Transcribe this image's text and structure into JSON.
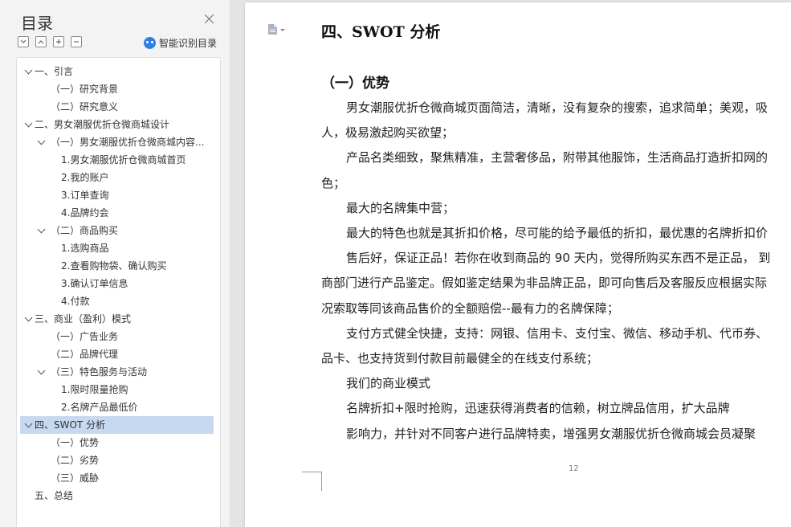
{
  "toc": {
    "title": "目录",
    "smart_label": "智能识别目录",
    "items": [
      {
        "label": "一、引言",
        "level": 0,
        "expanded": true
      },
      {
        "label": "（一）研究背景",
        "level": 1
      },
      {
        "label": "（二）研究意义",
        "level": 1
      },
      {
        "label": "二、男女潮服优折仓微商城设计",
        "level": 0,
        "expanded": true
      },
      {
        "label": "（一）男女潮服优折仓微商城内容...",
        "level": 1,
        "expanded": true
      },
      {
        "label": "1.男女潮服优折仓微商城首页",
        "level": 2
      },
      {
        "label": "2.我的账户",
        "level": 2
      },
      {
        "label": "3.订单查询",
        "level": 2
      },
      {
        "label": "4.品牌约会",
        "level": 2
      },
      {
        "label": "（二）商品购买",
        "level": 1,
        "expanded": true
      },
      {
        "label": "1.选购商品",
        "level": 2
      },
      {
        "label": "2.查看购物袋、确认购买",
        "level": 2
      },
      {
        "label": "3.确认订单信息",
        "level": 2
      },
      {
        "label": "4.付款",
        "level": 2
      },
      {
        "label": "三、商业（盈利）模式",
        "level": 0,
        "expanded": true
      },
      {
        "label": "（一）广告业务",
        "level": 1
      },
      {
        "label": "（二）品牌代理",
        "level": 1
      },
      {
        "label": "（三）特色服务与活动",
        "level": 1,
        "expanded": true
      },
      {
        "label": "1.限时限量抢购",
        "level": 2
      },
      {
        "label": "2.名牌产品最低价",
        "level": 2
      },
      {
        "label": "四、SWOT 分析",
        "level": 0,
        "expanded": true,
        "selected": true
      },
      {
        "label": "（一）优势",
        "level": 1
      },
      {
        "label": "（二）劣势",
        "level": 1
      },
      {
        "label": "（三）威胁",
        "level": 1
      },
      {
        "label": "五、总结",
        "level": 0
      }
    ]
  },
  "document": {
    "heading": "四、SWOT 分析",
    "subheading": "（一）优势",
    "lines": [
      {
        "text": "男女潮服优折仓微商城页面简洁，清晰，没有复杂的搜索，追求简单；美观，吸",
        "indent": true
      },
      {
        "text": "人，极易激起购买欲望；",
        "indent": false
      },
      {
        "text": "产品名类细致，聚焦精准，主营奢侈品，附带其他服饰，生活商品打造折扣网的",
        "indent": true
      },
      {
        "text": "色；",
        "indent": false
      },
      {
        "text": "最大的名牌集中营；",
        "indent": true
      },
      {
        "text": "最大的特色也就是其折扣价格，尽可能的给予最低的折扣，最优惠的名牌折扣价",
        "indent": true
      },
      {
        "text": "售后好，保证正品！若你在收到商品的 90 天内，觉得所购买东西不是正品， 到",
        "indent": true
      },
      {
        "text": "商部门进行产品鉴定。假如鉴定结果为非品牌正品，即可向售后及客服反应根据实际",
        "indent": false
      },
      {
        "text": "况索取等同该商品售价的全额赔偿--最有力的名牌保障；",
        "indent": false
      },
      {
        "text": "支付方式健全快捷，支持：网银、信用卡、支付宝、微信、移动手机、代币券、",
        "indent": true
      },
      {
        "text": "品卡、也支持货到付款目前最健全的在线支付系统；",
        "indent": false
      },
      {
        "text": "我们的商业模式",
        "indent": true
      },
      {
        "text": "名牌折扣+限时抢购，迅速获得消费者的信赖，树立牌品信用，扩大品牌",
        "indent": true
      },
      {
        "text": "影响力，并针对不同客户进行品牌特卖，增强男女潮服优折仓微商城会员凝聚",
        "indent": true
      }
    ],
    "page_number": "12"
  }
}
